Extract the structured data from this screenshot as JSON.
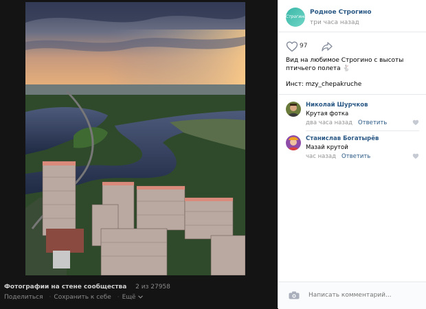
{
  "viewer": {
    "album_title": "Фотографии на стене сообщества",
    "counter": "2 из 27958",
    "actions": {
      "share": "Поделиться",
      "save": "Сохранить к себе",
      "more": "Ещё"
    },
    "icons": {
      "more_chevron": "chevron-down-icon"
    }
  },
  "post": {
    "avatar_text": "Строгино",
    "group_name": "Родное Строгино",
    "time": "три часа назад",
    "likes": "97",
    "text": "Вид на любимое Строгино с высоты птичьего полета 🐇",
    "instagram": "Инст: mzy_chepakruche",
    "icons": {
      "like": "heart-icon",
      "share": "share-arrow-icon"
    }
  },
  "comments": [
    {
      "author": "Николай Шурчков",
      "text": "Крутая фотка",
      "time": "два часа назад",
      "reply": "Ответить"
    },
    {
      "author": "Станислав Богатырёв",
      "text": "Мазай крутой",
      "time": "час назад",
      "reply": "Ответить"
    }
  ],
  "composer": {
    "placeholder": "Написать комментарий..."
  },
  "colors": {
    "link": "#2a5885",
    "muted": "#939393",
    "viewer_bg": "#141414"
  }
}
